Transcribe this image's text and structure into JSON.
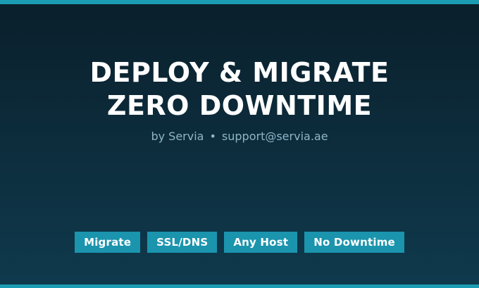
{
  "banner": {
    "title_line1": "DEPLOY & MIGRATE",
    "title_line2": "ZERO DOWNTIME",
    "byline": {
      "by": "by Servia",
      "separator": "•",
      "email": "support@servia.ae"
    },
    "tags": [
      "Migrate",
      "SSL/DNS",
      "Any Host",
      "No Downtime"
    ]
  },
  "colors": {
    "background_top": "#0a1f2b",
    "background_bottom": "#0f3a4d",
    "accent": "#1b9cb3",
    "tag_background": "#1b94ad",
    "byline_text": "#8fb6c6",
    "title_text": "#ffffff"
  }
}
